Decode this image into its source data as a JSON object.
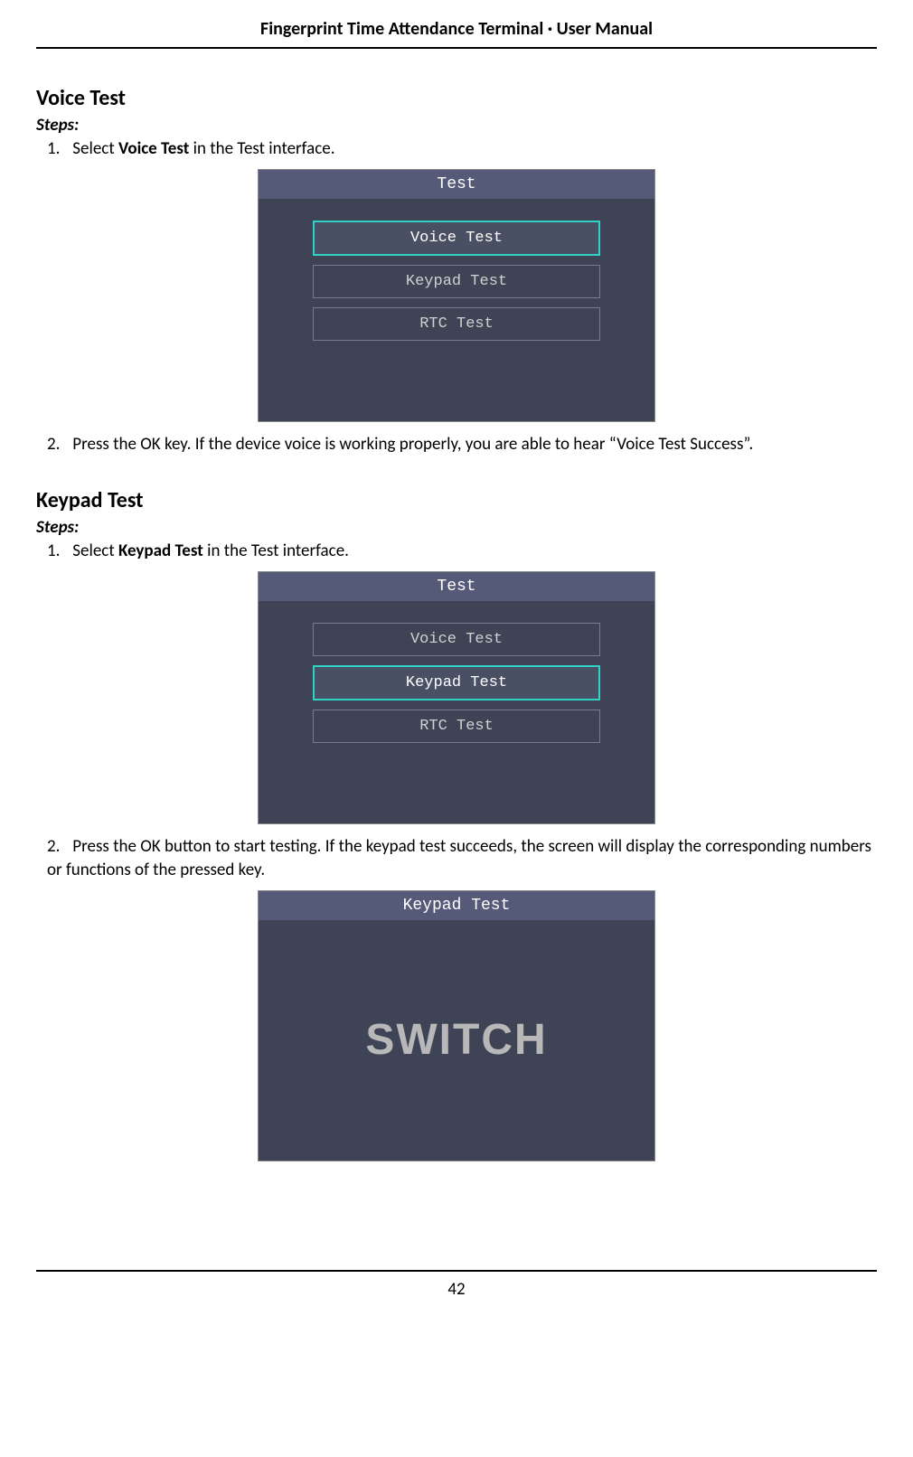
{
  "header": "Fingerprint Time Attendance Terminal · User Manual",
  "page_number": "42",
  "voice_test": {
    "title": "Voice Test",
    "steps_label": "Steps:",
    "step1_num": "1.",
    "step1_prefix": "Select ",
    "step1_bold": "Voice Test",
    "step1_suffix": " in the Test interface.",
    "step2_num": "2.",
    "step2_text": "Press the OK key. If the device voice is working properly, you are able to hear “Voice Test Success”.",
    "screen": {
      "title": "Test",
      "items": [
        "Voice Test",
        "Keypad Test",
        "RTC Test"
      ],
      "selected_index": 0
    }
  },
  "keypad_test": {
    "title": "Keypad Test",
    "steps_label": "Steps:",
    "step1_num": "1.",
    "step1_prefix": "Select ",
    "step1_bold": "Keypad Test",
    "step1_suffix": " in the Test interface.",
    "step2_num": "2.",
    "step2_text": "Press the OK button to start testing. If the keypad test succeeds, the screen will display the corresponding numbers or functions of the pressed key.",
    "screen": {
      "title": "Test",
      "items": [
        "Voice Test",
        "Keypad Test",
        "RTC Test"
      ],
      "selected_index": 1
    },
    "result_screen": {
      "title": "Keypad Test",
      "value": "SWITCH"
    }
  }
}
